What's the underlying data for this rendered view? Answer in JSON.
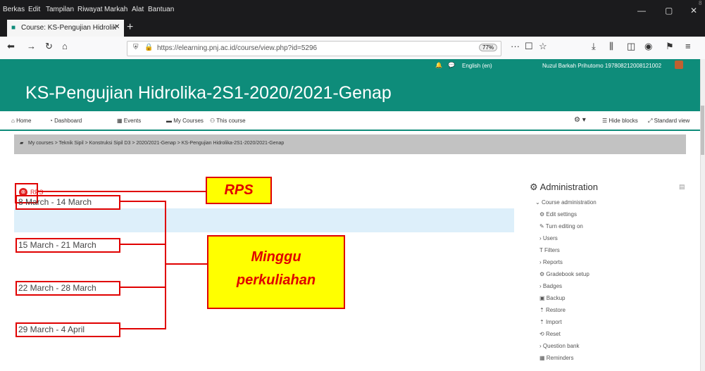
{
  "browser": {
    "menu": [
      "Berkas",
      "Edit",
      "Tampilan",
      "Riwayat",
      "Markah",
      "Alat",
      "Bantuan"
    ],
    "tab_title": "Course: KS-Pengujian Hidrolik",
    "url": "https://elearning.pnj.ac.id/course/view.php?id=5296",
    "zoom": "77%",
    "corner_number": "8"
  },
  "moodle": {
    "language": "English (en)",
    "user": "Nuzul Barkah Prihutomo 197808212008121002",
    "course_title": "KS-Pengujian Hidrolika-2S1-2020/2021-Genap",
    "nav": [
      "Home",
      "Dashboard",
      "Events",
      "My Courses",
      "This course"
    ],
    "nav_right": [
      "Hide blocks",
      "Standard view"
    ],
    "breadcrumb": "My courses > Teknik Sipil > Konstruksi Sipil D3 > 2020/2021-Genap > KS-Pengujian Hidrolika-2S1-2020/2021-Genap"
  },
  "content": {
    "rps_link": "RPS",
    "weeks": [
      "8 March - 14 March",
      "15 March - 21 March",
      "22 March - 28 March",
      "29 March - 4 April"
    ]
  },
  "callouts": {
    "rps": "RPS",
    "weeks_line1": "Minggu",
    "weeks_line2": "perkuliahan"
  },
  "admin": {
    "title": "Administration",
    "section": "Course administration",
    "items": [
      "Edit settings",
      "Turn editing on",
      "Users",
      "Filters",
      "Reports",
      "Gradebook setup",
      "Badges",
      "Backup",
      "Restore",
      "Import",
      "Reset",
      "Question bank",
      "Reminders"
    ]
  },
  "colors": {
    "moodle_green": "#0e8c7a",
    "callout_fill": "#ffff00",
    "annotation_red": "#e00000"
  }
}
